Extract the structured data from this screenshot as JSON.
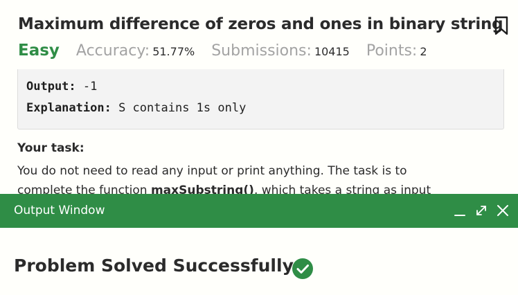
{
  "problem": {
    "title": "Maximum difference of zeros and ones in binary string",
    "difficulty": "Easy",
    "accuracy_label": "Accuracy:",
    "accuracy_value": "51.77%",
    "submissions_label": "Submissions:",
    "submissions_value": "10415",
    "points_label": "Points:",
    "points_value": "2",
    "bookmark_icon": "bookmark-icon"
  },
  "example": {
    "output_label": "Output:",
    "output_value": "-1",
    "explanation_label": "Explanation:",
    "explanation_value": "S contains 1s only"
  },
  "task": {
    "heading": "Your task:",
    "line1": "You do not need to read any input or print anything. The task is to",
    "line2_pre": "complete the function ",
    "function_name": "maxSubstring()",
    "line2_post": ", which takes a string as input"
  },
  "output_window": {
    "title": "Output Window",
    "minimize_icon": "minimize-icon",
    "expand_icon": "expand-icon",
    "close_icon": "close-icon",
    "result_text": "Problem Solved Successfully",
    "result_icon": "check-circle-icon",
    "accent_color": "#2f8d46"
  }
}
